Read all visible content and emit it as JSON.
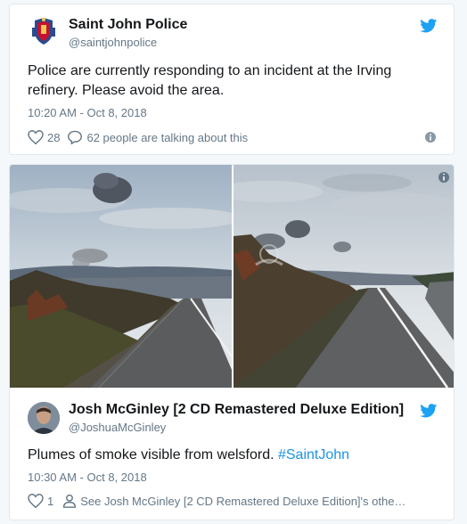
{
  "tweet1": {
    "name": "Saint John Police",
    "handle": "@saintjohnpolice",
    "text": "Police are currently responding to an incident at the Irving refinery. Please avoid the area.",
    "timestamp": "10:20 AM - Oct 8, 2018",
    "likes": "28",
    "conversation": "62 people are talking about this",
    "icons": [
      "police-crest-avatar",
      "twitter-bird-icon",
      "heart-icon",
      "reply-icon",
      "info-icon"
    ]
  },
  "tweet2": {
    "name": "Josh McGinley [2 CD Remastered Deluxe Edition]",
    "handle": "@JoshuaMcGinley",
    "text_prefix": "Plumes of smoke visible from welsford.",
    "hashtag": "#SaintJohn",
    "timestamp": "10:30 AM - Oct 8, 2018",
    "likes": "1",
    "profile_link": "See Josh McGinley [2 CD Remastered Deluxe Edition]'s othe…",
    "icons": [
      "twitter-bird-icon",
      "heart-icon",
      "person-icon",
      "info-icon"
    ]
  },
  "colors": {
    "twitter_blue": "#1da1f2",
    "text": "#14171a",
    "secondary": "#657786",
    "link": "#1b95e0"
  }
}
